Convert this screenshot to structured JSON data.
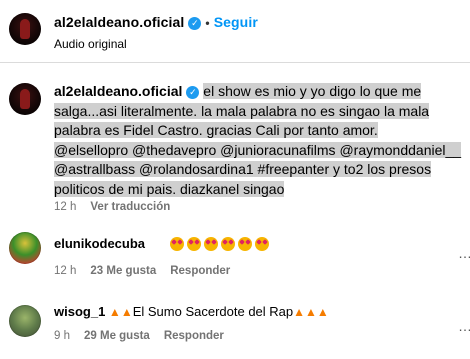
{
  "header": {
    "username": "al2elaldeano.oficial",
    "verified_icon": "verified-badge-icon",
    "separator": "•",
    "follow_label": "Seguir",
    "audio_label": "Audio original"
  },
  "caption": {
    "author": "al2elaldeano.oficial",
    "line1": "el show es mio y yo digo lo que me",
    "line2": "salga...asi literalmente. la mala palabra no es singao la mala",
    "line3": "palabra es Fidel Castro. gracias Cali por tanto amor.",
    "line4": "@elsellopro @thedavepro @junioracunafilms @raymonddaniel__",
    "line5": "@astrallbass @rolandosardina1 #freepanter y to2 los presos",
    "line6": "politicos de mi pais. diazkanel singao",
    "time": "12 h",
    "translate_label": "Ver traducción"
  },
  "comments": [
    {
      "username": "elunikodecuba",
      "text": "",
      "emoji": "star-struck-emoji x6",
      "time": "12 h",
      "likes": "23 Me gusta",
      "reply_label": "Responder"
    },
    {
      "username": "wisog_1",
      "text_prefix_emoji": "fire-emoji x2",
      "text": "El Sumo Sacerdote del Rap",
      "text_suffix_emoji": "fire-emoji x3",
      "time": "9 h",
      "likes": "29 Me gusta",
      "reply_label": "Responder"
    }
  ]
}
